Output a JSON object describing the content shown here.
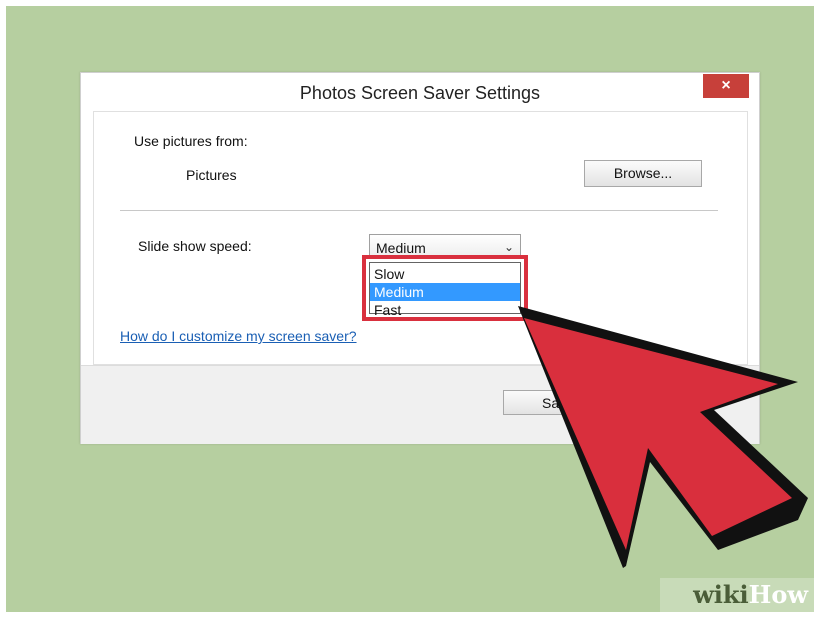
{
  "dialog": {
    "title": "Photos Screen Saver Settings",
    "close_label": "×"
  },
  "settings": {
    "source_label": "Use pictures from:",
    "source_value": "Pictures",
    "browse_label": "Browse...",
    "speed_label": "Slide show speed:",
    "speed_selected": "Medium",
    "speed_options": [
      "Slow",
      "Medium",
      "Fast"
    ],
    "help_link": "How do I customize my screen saver?"
  },
  "footer": {
    "save_label": "Sa"
  },
  "watermark": {
    "wiki": "wiki",
    "how": "How"
  },
  "colors": {
    "background": "#b6cfa0",
    "highlight": "#d9303e",
    "selection": "#3399ff"
  },
  "icons": {
    "chevron": "chevron-down-icon",
    "arrow": "red-pointer-arrow-icon"
  }
}
